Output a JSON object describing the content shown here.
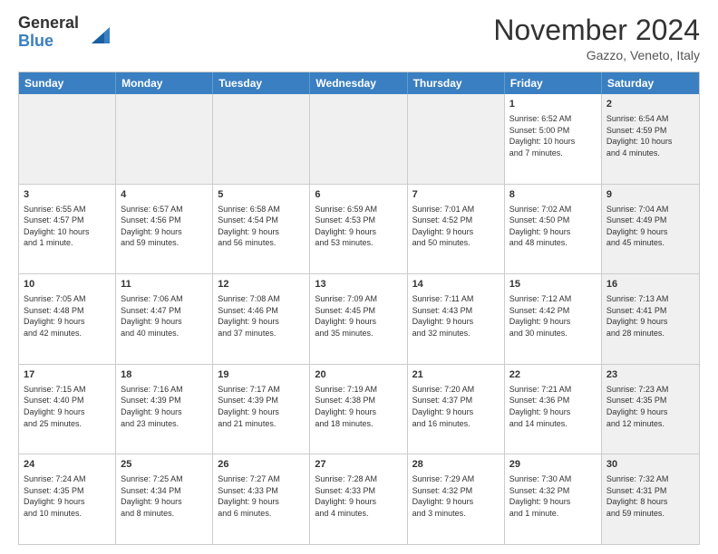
{
  "header": {
    "logo_general": "General",
    "logo_blue": "Blue",
    "month_title": "November 2024",
    "location": "Gazzo, Veneto, Italy"
  },
  "weekdays": [
    "Sunday",
    "Monday",
    "Tuesday",
    "Wednesday",
    "Thursday",
    "Friday",
    "Saturday"
  ],
  "rows": [
    [
      {
        "day": "",
        "text": "",
        "shaded": true
      },
      {
        "day": "",
        "text": "",
        "shaded": true
      },
      {
        "day": "",
        "text": "",
        "shaded": true
      },
      {
        "day": "",
        "text": "",
        "shaded": true
      },
      {
        "day": "",
        "text": "",
        "shaded": true
      },
      {
        "day": "1",
        "text": "Sunrise: 6:52 AM\nSunset: 5:00 PM\nDaylight: 10 hours\nand 7 minutes.",
        "shaded": false
      },
      {
        "day": "2",
        "text": "Sunrise: 6:54 AM\nSunset: 4:59 PM\nDaylight: 10 hours\nand 4 minutes.",
        "shaded": true
      }
    ],
    [
      {
        "day": "3",
        "text": "Sunrise: 6:55 AM\nSunset: 4:57 PM\nDaylight: 10 hours\nand 1 minute.",
        "shaded": false
      },
      {
        "day": "4",
        "text": "Sunrise: 6:57 AM\nSunset: 4:56 PM\nDaylight: 9 hours\nand 59 minutes.",
        "shaded": false
      },
      {
        "day": "5",
        "text": "Sunrise: 6:58 AM\nSunset: 4:54 PM\nDaylight: 9 hours\nand 56 minutes.",
        "shaded": false
      },
      {
        "day": "6",
        "text": "Sunrise: 6:59 AM\nSunset: 4:53 PM\nDaylight: 9 hours\nand 53 minutes.",
        "shaded": false
      },
      {
        "day": "7",
        "text": "Sunrise: 7:01 AM\nSunset: 4:52 PM\nDaylight: 9 hours\nand 50 minutes.",
        "shaded": false
      },
      {
        "day": "8",
        "text": "Sunrise: 7:02 AM\nSunset: 4:50 PM\nDaylight: 9 hours\nand 48 minutes.",
        "shaded": false
      },
      {
        "day": "9",
        "text": "Sunrise: 7:04 AM\nSunset: 4:49 PM\nDaylight: 9 hours\nand 45 minutes.",
        "shaded": true
      }
    ],
    [
      {
        "day": "10",
        "text": "Sunrise: 7:05 AM\nSunset: 4:48 PM\nDaylight: 9 hours\nand 42 minutes.",
        "shaded": false
      },
      {
        "day": "11",
        "text": "Sunrise: 7:06 AM\nSunset: 4:47 PM\nDaylight: 9 hours\nand 40 minutes.",
        "shaded": false
      },
      {
        "day": "12",
        "text": "Sunrise: 7:08 AM\nSunset: 4:46 PM\nDaylight: 9 hours\nand 37 minutes.",
        "shaded": false
      },
      {
        "day": "13",
        "text": "Sunrise: 7:09 AM\nSunset: 4:45 PM\nDaylight: 9 hours\nand 35 minutes.",
        "shaded": false
      },
      {
        "day": "14",
        "text": "Sunrise: 7:11 AM\nSunset: 4:43 PM\nDaylight: 9 hours\nand 32 minutes.",
        "shaded": false
      },
      {
        "day": "15",
        "text": "Sunrise: 7:12 AM\nSunset: 4:42 PM\nDaylight: 9 hours\nand 30 minutes.",
        "shaded": false
      },
      {
        "day": "16",
        "text": "Sunrise: 7:13 AM\nSunset: 4:41 PM\nDaylight: 9 hours\nand 28 minutes.",
        "shaded": true
      }
    ],
    [
      {
        "day": "17",
        "text": "Sunrise: 7:15 AM\nSunset: 4:40 PM\nDaylight: 9 hours\nand 25 minutes.",
        "shaded": false
      },
      {
        "day": "18",
        "text": "Sunrise: 7:16 AM\nSunset: 4:39 PM\nDaylight: 9 hours\nand 23 minutes.",
        "shaded": false
      },
      {
        "day": "19",
        "text": "Sunrise: 7:17 AM\nSunset: 4:39 PM\nDaylight: 9 hours\nand 21 minutes.",
        "shaded": false
      },
      {
        "day": "20",
        "text": "Sunrise: 7:19 AM\nSunset: 4:38 PM\nDaylight: 9 hours\nand 18 minutes.",
        "shaded": false
      },
      {
        "day": "21",
        "text": "Sunrise: 7:20 AM\nSunset: 4:37 PM\nDaylight: 9 hours\nand 16 minutes.",
        "shaded": false
      },
      {
        "day": "22",
        "text": "Sunrise: 7:21 AM\nSunset: 4:36 PM\nDaylight: 9 hours\nand 14 minutes.",
        "shaded": false
      },
      {
        "day": "23",
        "text": "Sunrise: 7:23 AM\nSunset: 4:35 PM\nDaylight: 9 hours\nand 12 minutes.",
        "shaded": true
      }
    ],
    [
      {
        "day": "24",
        "text": "Sunrise: 7:24 AM\nSunset: 4:35 PM\nDaylight: 9 hours\nand 10 minutes.",
        "shaded": false
      },
      {
        "day": "25",
        "text": "Sunrise: 7:25 AM\nSunset: 4:34 PM\nDaylight: 9 hours\nand 8 minutes.",
        "shaded": false
      },
      {
        "day": "26",
        "text": "Sunrise: 7:27 AM\nSunset: 4:33 PM\nDaylight: 9 hours\nand 6 minutes.",
        "shaded": false
      },
      {
        "day": "27",
        "text": "Sunrise: 7:28 AM\nSunset: 4:33 PM\nDaylight: 9 hours\nand 4 minutes.",
        "shaded": false
      },
      {
        "day": "28",
        "text": "Sunrise: 7:29 AM\nSunset: 4:32 PM\nDaylight: 9 hours\nand 3 minutes.",
        "shaded": false
      },
      {
        "day": "29",
        "text": "Sunrise: 7:30 AM\nSunset: 4:32 PM\nDaylight: 9 hours\nand 1 minute.",
        "shaded": false
      },
      {
        "day": "30",
        "text": "Sunrise: 7:32 AM\nSunset: 4:31 PM\nDaylight: 8 hours\nand 59 minutes.",
        "shaded": true
      }
    ]
  ]
}
